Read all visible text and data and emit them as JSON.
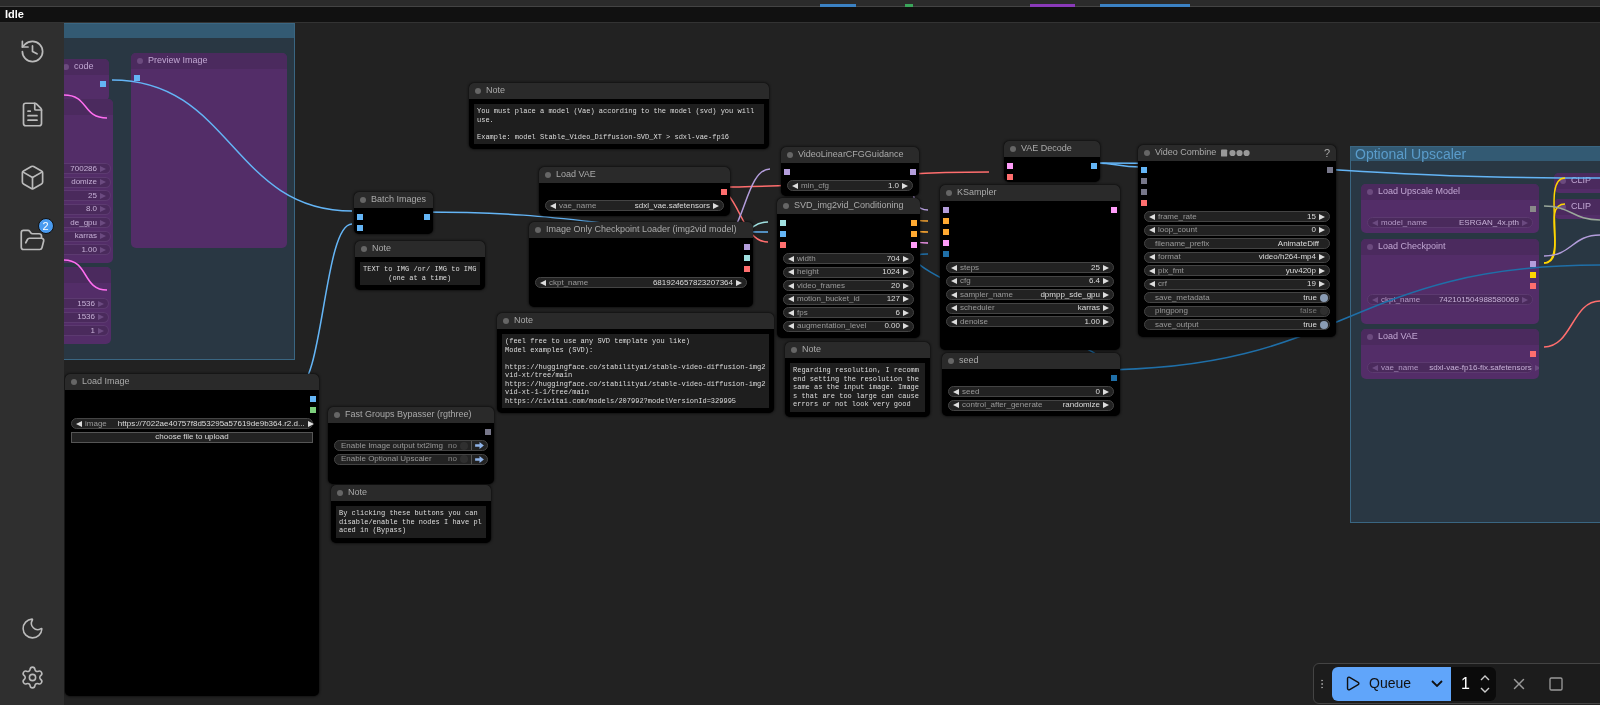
{
  "top_bar": {
    "status": "Idle"
  },
  "sidebar": {
    "badge": "2"
  },
  "groups": [
    {
      "nodes": [
        {
          "title": "code",
          "kind": "node",
          "bypassed": true,
          "outputs": [
            {
              "color": "#64b5f6"
            }
          ]
        },
        {
          "title": "Preview Image",
          "kind": "node",
          "bypassed": true,
          "inputs": [
            {
              "color": "#64b5f6"
            }
          ]
        },
        {
          "kind": "node",
          "bypassed": true,
          "widgets": [
            {
              "kind": "value",
              "value": "700286"
            },
            {
              "kind": "value",
              "value": "domize"
            },
            {
              "kind": "value",
              "value": "25"
            },
            {
              "kind": "value",
              "value": "8.0"
            },
            {
              "kind": "value",
              "value": "de_gpu"
            },
            {
              "kind": "value",
              "value": "karras"
            },
            {
              "kind": "value",
              "value": "1.00"
            }
          ]
        },
        {
          "kind": "node",
          "bypassed": true,
          "widgets": [
            {
              "kind": "value",
              "value": "1536"
            },
            {
              "kind": "value",
              "value": "1536"
            },
            {
              "kind": "value",
              "value": "1"
            }
          ]
        }
      ]
    },
    {
      "title": "Optional Upscaler",
      "nodes": [
        {
          "title": "Load Upscale Model",
          "kind": "node",
          "bypassed": true,
          "outputs": [
            {
              "color": "#8a8a8a"
            }
          ],
          "widgets": [
            {
              "kind": "combo",
              "label": "model_name",
              "value": "ESRGAN_4x.pth"
            }
          ]
        },
        {
          "title": "Load Checkpoint",
          "kind": "node",
          "bypassed": true,
          "outputs": [
            {
              "color": "#b39ddb"
            },
            {
              "color": "#ffd500"
            },
            {
              "color": "#ff6e6e"
            }
          ],
          "widgets": [
            {
              "kind": "combo",
              "label": "ckpt_name",
              "value": "742101504988580069"
            }
          ]
        },
        {
          "title": "Load VAE",
          "kind": "node",
          "bypassed": true,
          "outputs": [
            {
              "color": "#ff6e6e"
            }
          ],
          "widgets": [
            {
              "kind": "combo",
              "label": "vae_name",
              "value": "sdxl-vae-fp16-fix.safetensors"
            }
          ]
        },
        {
          "title": "CLIP",
          "kind": "node",
          "bypassed": true
        },
        {
          "title": "CLIP",
          "kind": "node",
          "bypassed": true
        }
      ]
    }
  ],
  "nodes": [
    {
      "title": "Load Image",
      "kind": "node",
      "outputs": [
        {
          "color": "#64b5f6"
        },
        {
          "color": "#7ccf7c"
        }
      ],
      "widgets": [
        {
          "kind": "combo",
          "label": "image",
          "value": "https://7022ae40757f8d53295a57619de9b364.r2.d..."
        },
        {
          "kind": "button",
          "label": "choose file to upload"
        }
      ]
    },
    {
      "title": "Batch Images",
      "kind": "node",
      "inputs": [
        {
          "color": "#64b5f6"
        },
        {
          "color": "#64b5f6"
        }
      ],
      "outputs": [
        {
          "color": "#64b5f6"
        }
      ]
    },
    {
      "title": "Note",
      "kind": "note",
      "text": "TEXT to IMG /or/ IMG to IMG\n      (one at a time)"
    },
    {
      "title": "Fast Groups Bypasser (rgthree)",
      "kind": "node",
      "outputs": [
        {
          "color": "#77778a"
        }
      ],
      "widgets": [
        {
          "kind": "switch",
          "label": "Enable Image output txt2img",
          "value": "no",
          "on": false
        },
        {
          "kind": "switch",
          "label": "Enable Optional Upscaler",
          "value": "no",
          "on": false
        }
      ]
    },
    {
      "title": "Note",
      "kind": "note",
      "text": "By clicking these buttons you can disable/enable the nodes I have placed in (Bypass)"
    },
    {
      "title": "Note",
      "kind": "note",
      "text": "You must place a model (Vae) according to the model (svd) you will use.\n\nExample: model Stable_Video_Diffusion-SVD_XT > sdxl-vae-fp16"
    },
    {
      "title": "Load VAE",
      "kind": "node",
      "outputs": [
        {
          "color": "#ff6e6e"
        }
      ],
      "widgets": [
        {
          "kind": "combo",
          "label": "vae_name",
          "value": "sdxl_vae.safetensors"
        }
      ]
    },
    {
      "title": "Image Only Checkpoint Loader (img2vid model)",
      "kind": "node",
      "outputs": [
        {
          "color": "#b39ddb"
        },
        {
          "color": "#a0e0e0"
        },
        {
          "color": "#ff6e6e"
        }
      ],
      "widgets": [
        {
          "kind": "combo",
          "label": "ckpt_name",
          "value": "681924657823207364"
        }
      ]
    },
    {
      "title": "Note",
      "kind": "note",
      "text": "(feel free to use any SVD template you like)\nModel examples (SVD):\n\nhttps://huggingface.co/stabilityai/stable-video-diffusion-img2vid-xt/tree/main\nhttps://huggingface.co/stabilityai/stable-video-diffusion-img2vid-xt-1-1/tree/main\nhttps://civitai.com/models/207992?modelVersionId=329995"
    },
    {
      "title": "VideoLinearCFGGuidance",
      "kind": "node",
      "inputs": [
        {
          "color": "#b39ddb"
        }
      ],
      "outputs": [
        {
          "color": "#b39ddb"
        }
      ],
      "widgets": [
        {
          "kind": "combo",
          "label": "min_cfg",
          "value": "1.0"
        }
      ]
    },
    {
      "title": "SVD_img2vid_Conditioning",
      "kind": "node",
      "inputs": [
        {
          "color": "#a0e0e0"
        },
        {
          "color": "#64b5f6"
        },
        {
          "color": "#ff6e6e"
        }
      ],
      "outputs": [
        {
          "color": "#ffa931"
        },
        {
          "color": "#ffa931"
        },
        {
          "color": "#ff9cf9"
        }
      ],
      "widgets": [
        {
          "kind": "combo",
          "label": "width",
          "value": "704"
        },
        {
          "kind": "combo",
          "label": "height",
          "value": "1024"
        },
        {
          "kind": "combo",
          "label": "video_frames",
          "value": "20"
        },
        {
          "kind": "combo",
          "label": "motion_bucket_id",
          "value": "127"
        },
        {
          "kind": "combo",
          "label": "fps",
          "value": "6"
        },
        {
          "kind": "combo",
          "label": "augmentation_level",
          "value": "0.00"
        }
      ]
    },
    {
      "title": "Note",
      "kind": "note",
      "text": "Regarding resolution, I recommend setting the resolution the same as the input image. Images that are too large can cause errors or not look very good"
    },
    {
      "title": "VAE Decode",
      "kind": "node",
      "inputs": [
        {
          "color": "#ff9cf9"
        },
        {
          "color": "#ff6e6e"
        }
      ],
      "outputs": [
        {
          "color": "#64b5f6"
        }
      ]
    },
    {
      "title": "KSampler",
      "kind": "node",
      "inputs": [
        {
          "color": "#b39ddb"
        },
        {
          "color": "#ffa931"
        },
        {
          "color": "#ffa931"
        },
        {
          "color": "#ff9cf9"
        },
        {
          "color": "#1f6fa8"
        }
      ],
      "outputs": [
        {
          "color": "#ff9cf9"
        }
      ],
      "widgets": [
        {
          "kind": "combo",
          "label": "steps",
          "value": "25"
        },
        {
          "kind": "combo",
          "label": "cfg",
          "value": "6.4"
        },
        {
          "kind": "combo",
          "label": "sampler_name",
          "value": "dpmpp_sde_gpu"
        },
        {
          "kind": "combo",
          "label": "scheduler",
          "value": "karras"
        },
        {
          "kind": "combo",
          "label": "denoise",
          "value": "1.00"
        }
      ]
    },
    {
      "title": "seed",
      "kind": "node",
      "outputs": [
        {
          "color": "#1f6fa8"
        }
      ],
      "widgets": [
        {
          "kind": "combo",
          "label": "seed",
          "value": "0"
        },
        {
          "kind": "combo",
          "label": "control_after_generate",
          "value": "randomize"
        }
      ]
    },
    {
      "title": "Video Combine",
      "title_icons": true,
      "help": "?",
      "kind": "node",
      "inputs": [
        {
          "color": "#64b5f6"
        },
        {
          "color": "#77778a"
        },
        {
          "color": "#77778a"
        },
        {
          "color": "#ff6e6e"
        }
      ],
      "outputs": [
        {
          "color": "#77778a"
        }
      ],
      "widgets": [
        {
          "kind": "combo",
          "label": "frame_rate",
          "value": "15"
        },
        {
          "kind": "combo",
          "label": "loop_count",
          "value": "0"
        },
        {
          "kind": "text",
          "label": "filename_prefix",
          "value": "AnimateDiff"
        },
        {
          "kind": "combo",
          "label": "format",
          "value": "video/h264-mp4"
        },
        {
          "kind": "combo",
          "label": "pix_fmt",
          "value": "yuv420p"
        },
        {
          "kind": "combo",
          "label": "crf",
          "value": "19"
        },
        {
          "kind": "toggle",
          "label": "save_metadata",
          "value": "true",
          "on": true
        },
        {
          "kind": "toggle",
          "label": "pingpong",
          "value": "false",
          "on": false
        },
        {
          "kind": "toggle",
          "label": "save_output",
          "value": "true",
          "on": true
        }
      ]
    }
  ],
  "queue": {
    "label": "Queue",
    "count": "1"
  }
}
